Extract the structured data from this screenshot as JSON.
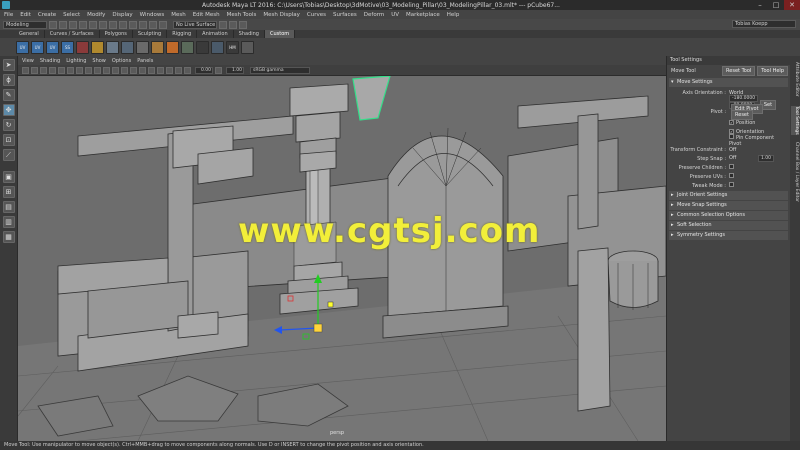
{
  "window": {
    "title": "Autodesk Maya LT 2016: C:\\Users\\Tobias\\Desktop\\3dMotive\\03_Modeling_Pillar\\03_ModelingPillar_03.mlt*  ---  pCube67...",
    "minimize": "–",
    "maximize": "□",
    "close": "✕"
  },
  "menu": [
    "File",
    "Edit",
    "Create",
    "Select",
    "Modify",
    "Display",
    "Windows",
    "Mesh",
    "Edit Mesh",
    "Mesh Tools",
    "Mesh Display",
    "Curves",
    "Surfaces",
    "Deform",
    "UV",
    "Marketplace",
    "Help"
  ],
  "status": {
    "mode": "Modeling",
    "live_surface": "No Live Surface",
    "user": "Tobias Koepp"
  },
  "shelf": {
    "tabs": [
      "General",
      "Curves / Surfaces",
      "Polygons",
      "Sculpting",
      "Rigging",
      "Animation",
      "Shading",
      "Custom"
    ],
    "active_tab": "Custom",
    "icons": [
      "UV",
      "UV",
      "UV",
      "SS",
      "",
      "",
      "",
      "",
      "",
      "",
      "",
      "",
      "",
      "",
      "HM",
      ""
    ]
  },
  "viewport": {
    "menu": [
      "View",
      "Shading",
      "Lighting",
      "Show",
      "Options",
      "Panels"
    ],
    "field1": "0.00",
    "field2": "1.00",
    "color_space": "sRGB gamma",
    "camera": "persp"
  },
  "watermark": "www.cgtsj.com",
  "tool_settings": {
    "header": "Tool Settings",
    "tool_name": "Move Tool",
    "reset_tool": "Reset Tool",
    "tool_help": "Tool Help",
    "move_settings": "Move Settings",
    "axis_orientation_label": "Axis Orientation :",
    "axis_orientation_value": "World",
    "axis_val1": "-180.0000",
    "axis_val2": "-90.0000",
    "set_label": "Set",
    "pivot_label": "Pivot :",
    "edit_pivot": "Edit Pivot",
    "reset_label": "Reset",
    "position": "Position",
    "orientation": "Orientation",
    "pin_component_pivot": "Pin Component Pivot",
    "transform_constraint_label": "Transform Constraint :",
    "transform_constraint_value": "Off",
    "step_snap_label": "Step Snap :",
    "step_snap_value": "Off",
    "step_snap_num": "1.00",
    "preserve_children": "Preserve Children :",
    "preserve_uvs": "Preserve UVs :",
    "tweak_mode": "Tweak Mode :",
    "sections": [
      "Joint Orient Settings",
      "Move Snap Settings",
      "Common Selection Options",
      "Soft Selection",
      "Symmetry Settings"
    ]
  },
  "side_tabs": [
    "Attribute Editor",
    "Tool Settings",
    "Channel Box / Layer Editor"
  ],
  "help_line": "Move Tool: Use manipulator to move object(s). Ctrl+MMB+drag to move components along normals. Use D or INSERT to change the pivot position and axis orientation."
}
